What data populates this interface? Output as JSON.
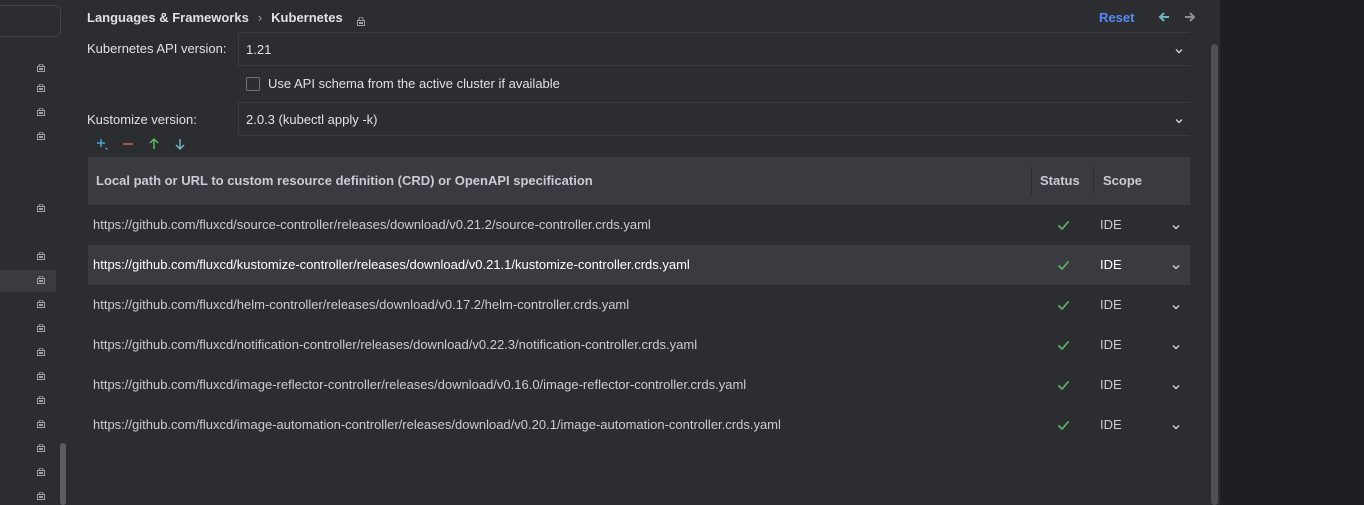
{
  "breadcrumb": {
    "parent": "Languages & Frameworks",
    "separator": "›",
    "current": "Kubernetes"
  },
  "header": {
    "reset_label": "Reset"
  },
  "settings": {
    "api_version_label": "Kubernetes API version:",
    "api_version_value": "1.21",
    "use_schema_label": "Use API schema from the active cluster if available",
    "kustomize_label": "Kustomize version:",
    "kustomize_value": "2.0.3 (kubectl apply -k)"
  },
  "toolbar": {
    "icons": [
      "add-icon",
      "remove-icon",
      "move-up-icon",
      "move-down-icon"
    ]
  },
  "table": {
    "columns": {
      "path": "Local path or URL to custom resource definition (CRD) or OpenAPI specification",
      "status": "Status",
      "scope": "Scope"
    },
    "rows": [
      {
        "url": "https://github.com/fluxcd/source-controller/releases/download/v0.21.2/source-controller.crds.yaml",
        "scope": "IDE"
      },
      {
        "url": "https://github.com/fluxcd/kustomize-controller/releases/download/v0.21.1/kustomize-controller.crds.yaml",
        "scope": "IDE"
      },
      {
        "url": "https://github.com/fluxcd/helm-controller/releases/download/v0.17.2/helm-controller.crds.yaml",
        "scope": "IDE"
      },
      {
        "url": "https://github.com/fluxcd/notification-controller/releases/download/v0.22.3/notification-controller.crds.yaml",
        "scope": "IDE"
      },
      {
        "url": "https://github.com/fluxcd/image-reflector-controller/releases/download/v0.16.0/image-reflector-controller.crds.yaml",
        "scope": "IDE"
      },
      {
        "url": "https://github.com/fluxcd/image-automation-controller/releases/download/v0.20.1/image-automation-controller.crds.yaml",
        "scope": "IDE"
      }
    ]
  },
  "colors": {
    "background": "#2b2d30",
    "accent": "#548af7",
    "status_ok": "#5fb865",
    "header_bg": "#393b40"
  }
}
